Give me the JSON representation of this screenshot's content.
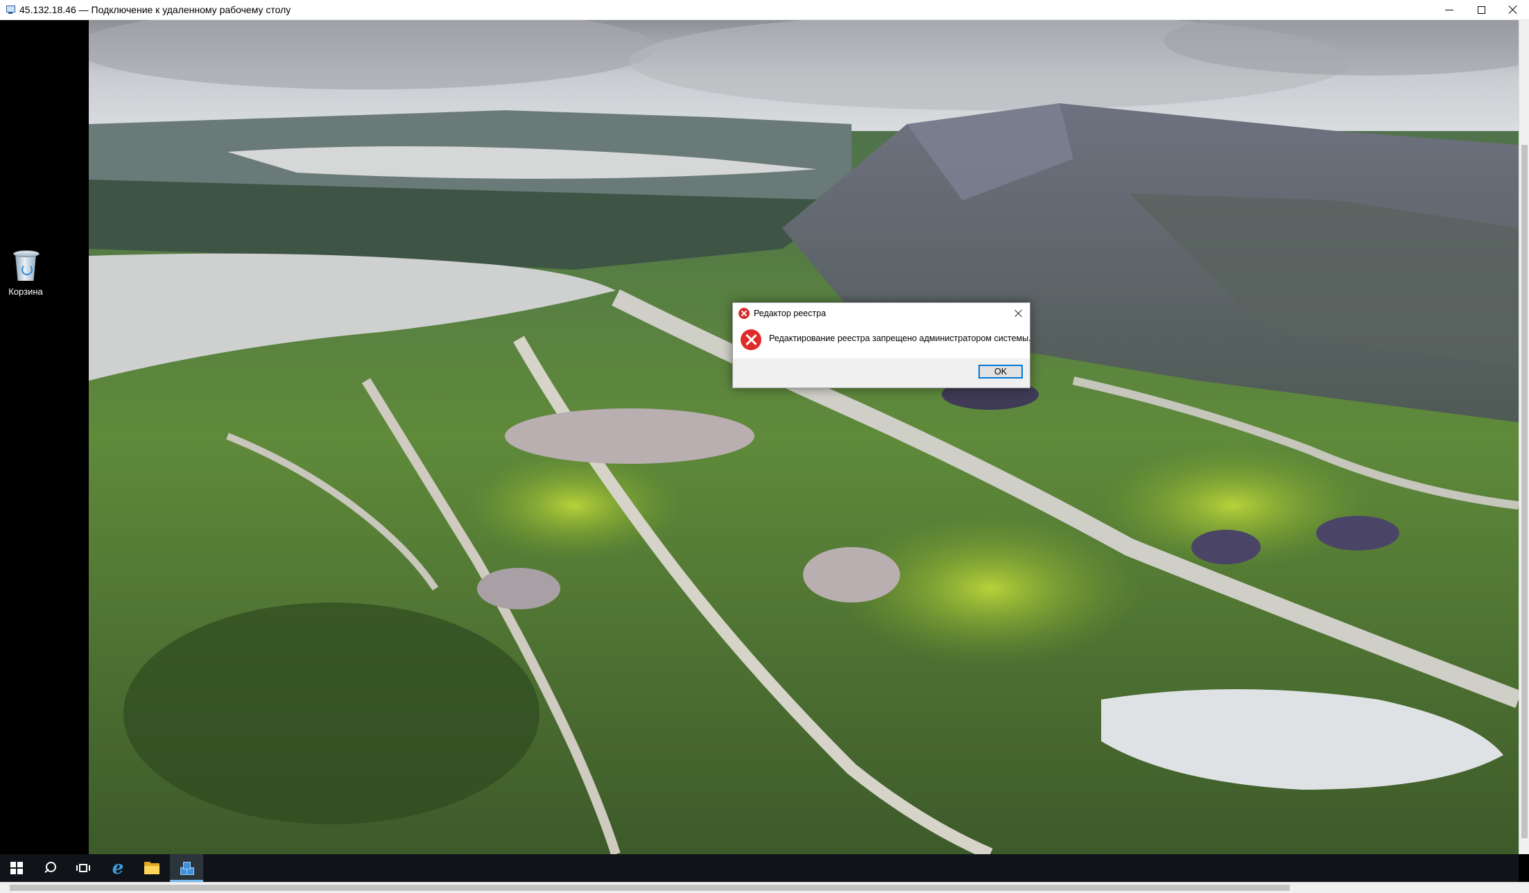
{
  "rdp_window": {
    "title": "45.132.18.46 — Подключение к удаленному рабочему столу"
  },
  "desktop": {
    "icons": [
      {
        "label": "Корзина",
        "icon": "recycle-bin-icon"
      }
    ]
  },
  "dialog": {
    "title": "Редактор реестра",
    "message": "Редактирование реестра запрещено администратором системы.",
    "ok_label": "OK",
    "icon": "error-icon"
  },
  "taskbar": {
    "items": [
      {
        "name": "start",
        "icon": "windows-logo-icon"
      },
      {
        "name": "search",
        "icon": "search-icon"
      },
      {
        "name": "task-view",
        "icon": "task-view-icon"
      },
      {
        "name": "internet-explorer",
        "icon": "internet-explorer-icon"
      },
      {
        "name": "file-explorer",
        "icon": "folder-icon"
      },
      {
        "name": "registry-editor",
        "icon": "regedit-icon",
        "active": true
      }
    ]
  },
  "colors": {
    "taskbar": "#101418",
    "accent": "#0078d7",
    "error": "#e02b2b"
  }
}
